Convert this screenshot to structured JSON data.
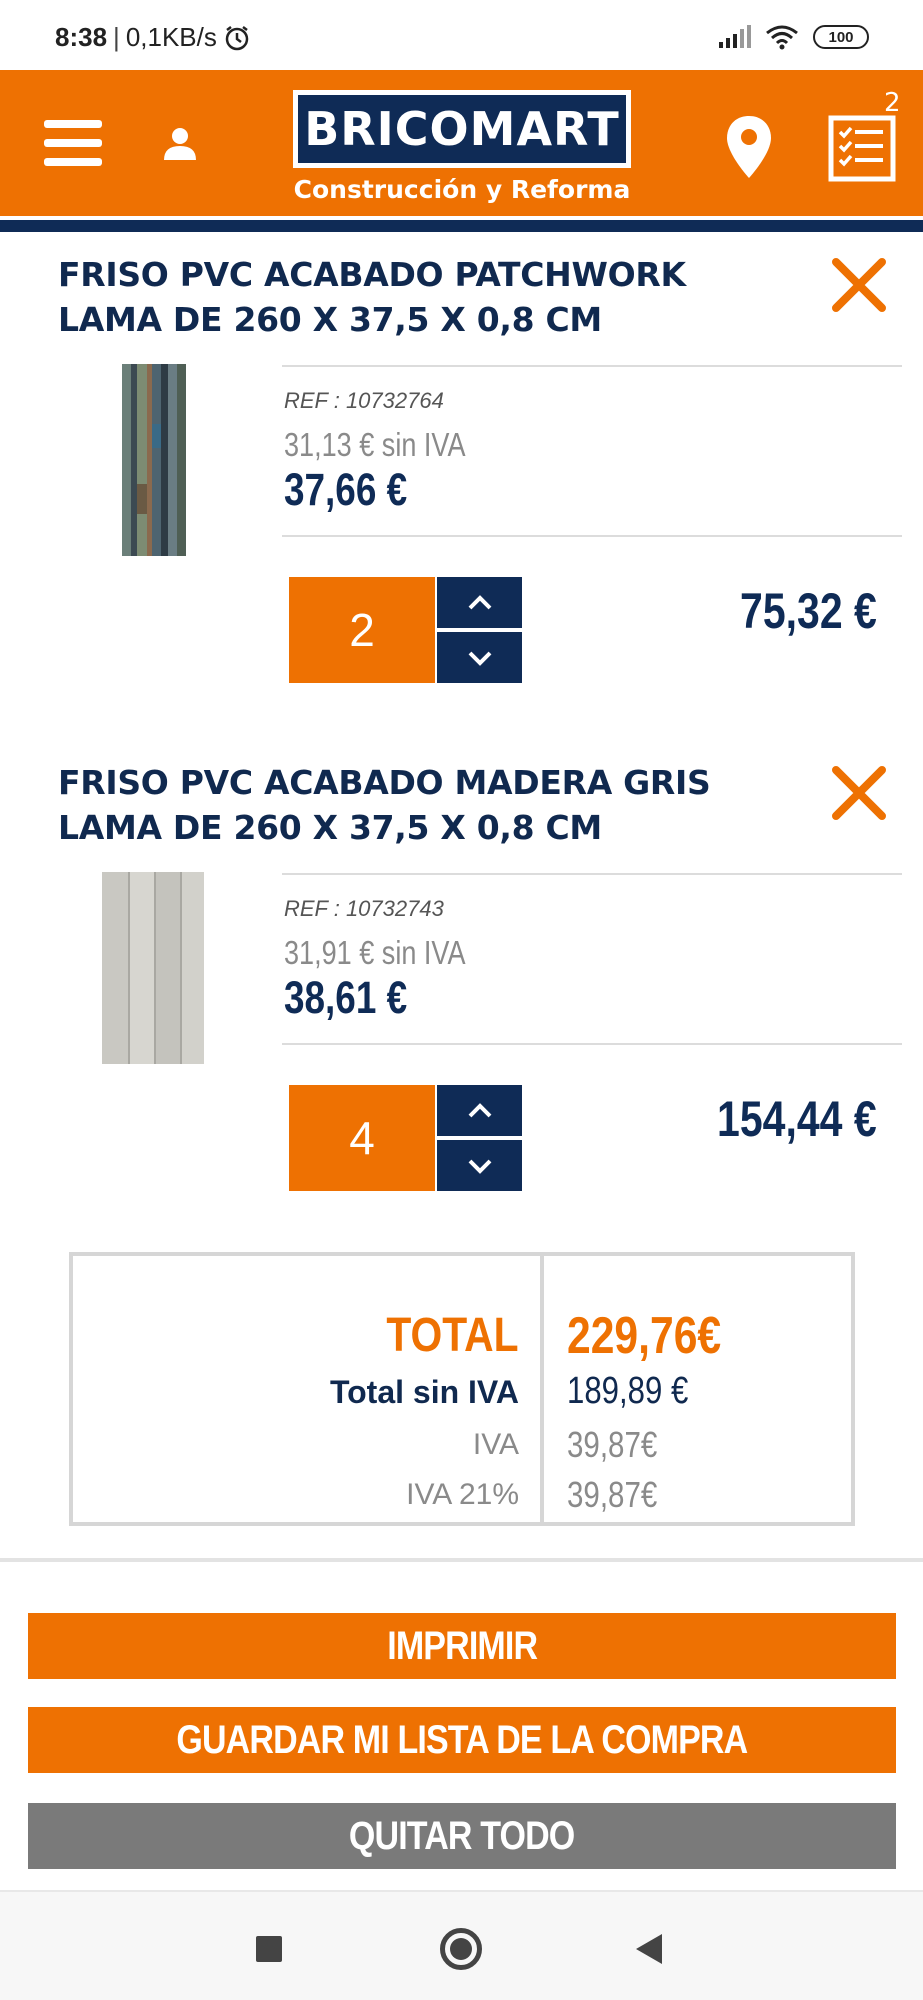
{
  "status_bar": {
    "time": "8:38",
    "separator": "|",
    "network_speed": "0,1KB/s",
    "battery": "100"
  },
  "header": {
    "brand": "BRICOMART",
    "tagline": "Construcción y Reforma",
    "list_count": "2",
    "colors": {
      "primary": "#ee7102",
      "navy": "#0f2b56"
    }
  },
  "items": [
    {
      "title": "FRISO PVC ACABADO PATCHWORK LAMA DE 260 X 37,5 X 0,8 CM",
      "ref": "REF : 10732764",
      "price_net": "31,13 € sin IVA",
      "price": "37,66 €",
      "quantity": "2",
      "line_total": "75,32 €"
    },
    {
      "title": "FRISO PVC ACABADO MADERA GRIS LAMA DE 260 X 37,5 X 0,8 CM",
      "ref": "REF : 10732743",
      "price_net": "31,91 € sin IVA",
      "price": "38,61 €",
      "quantity": "4",
      "line_total": "154,44 €"
    }
  ],
  "totals": {
    "total_label": "TOTAL",
    "total_value": "229,76€",
    "net_label": "Total sin IVA",
    "net_value": "189,89 €",
    "iva_label": "IVA",
    "iva_value": "39,87€",
    "iva21_label": "IVA 21%",
    "iva21_value": "39,87€"
  },
  "actions": {
    "print": "IMPRIMIR",
    "save": "GUARDAR MI LISTA DE LA COMPRA",
    "remove_all": "QUITAR TODO"
  }
}
